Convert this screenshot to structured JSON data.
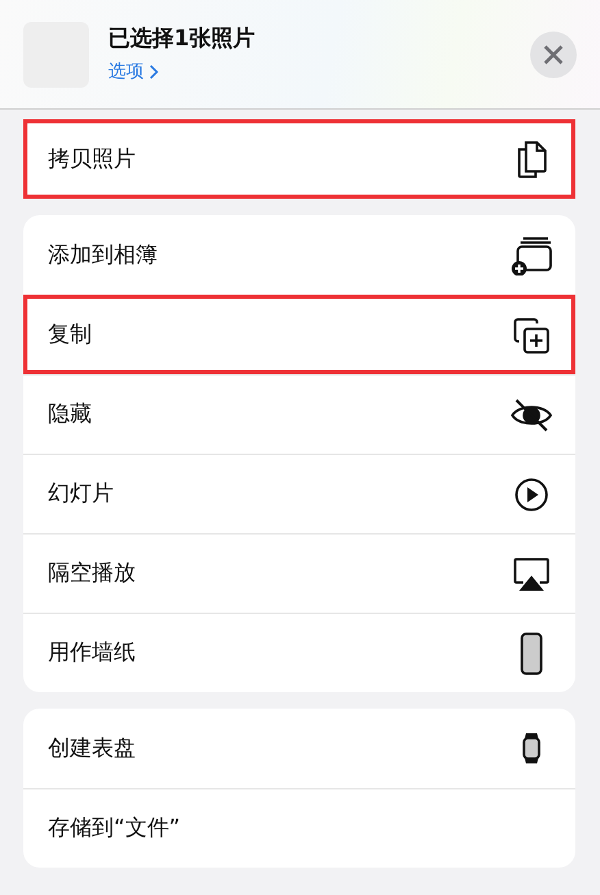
{
  "header": {
    "title": "已选择1张照片",
    "options_link": "选项"
  },
  "groups": [
    {
      "items": [
        {
          "label": "拷贝照片",
          "kind": "copy",
          "highlighted": true
        }
      ]
    },
    {
      "items": [
        {
          "label": "添加到相簿",
          "kind": "album",
          "highlighted": false
        },
        {
          "label": "复制",
          "kind": "duplicate",
          "highlighted": true
        },
        {
          "label": "隐藏",
          "kind": "hide",
          "highlighted": false
        },
        {
          "label": "幻灯片",
          "kind": "play",
          "highlighted": false
        },
        {
          "label": "隔空播放",
          "kind": "airplay",
          "highlighted": false
        },
        {
          "label": "用作墙纸",
          "kind": "phone",
          "highlighted": false
        }
      ]
    },
    {
      "items": [
        {
          "label": "创建表盘",
          "kind": "watch",
          "highlighted": false
        },
        {
          "label": "存储到“文件”",
          "kind": "files",
          "highlighted": false
        }
      ]
    }
  ]
}
